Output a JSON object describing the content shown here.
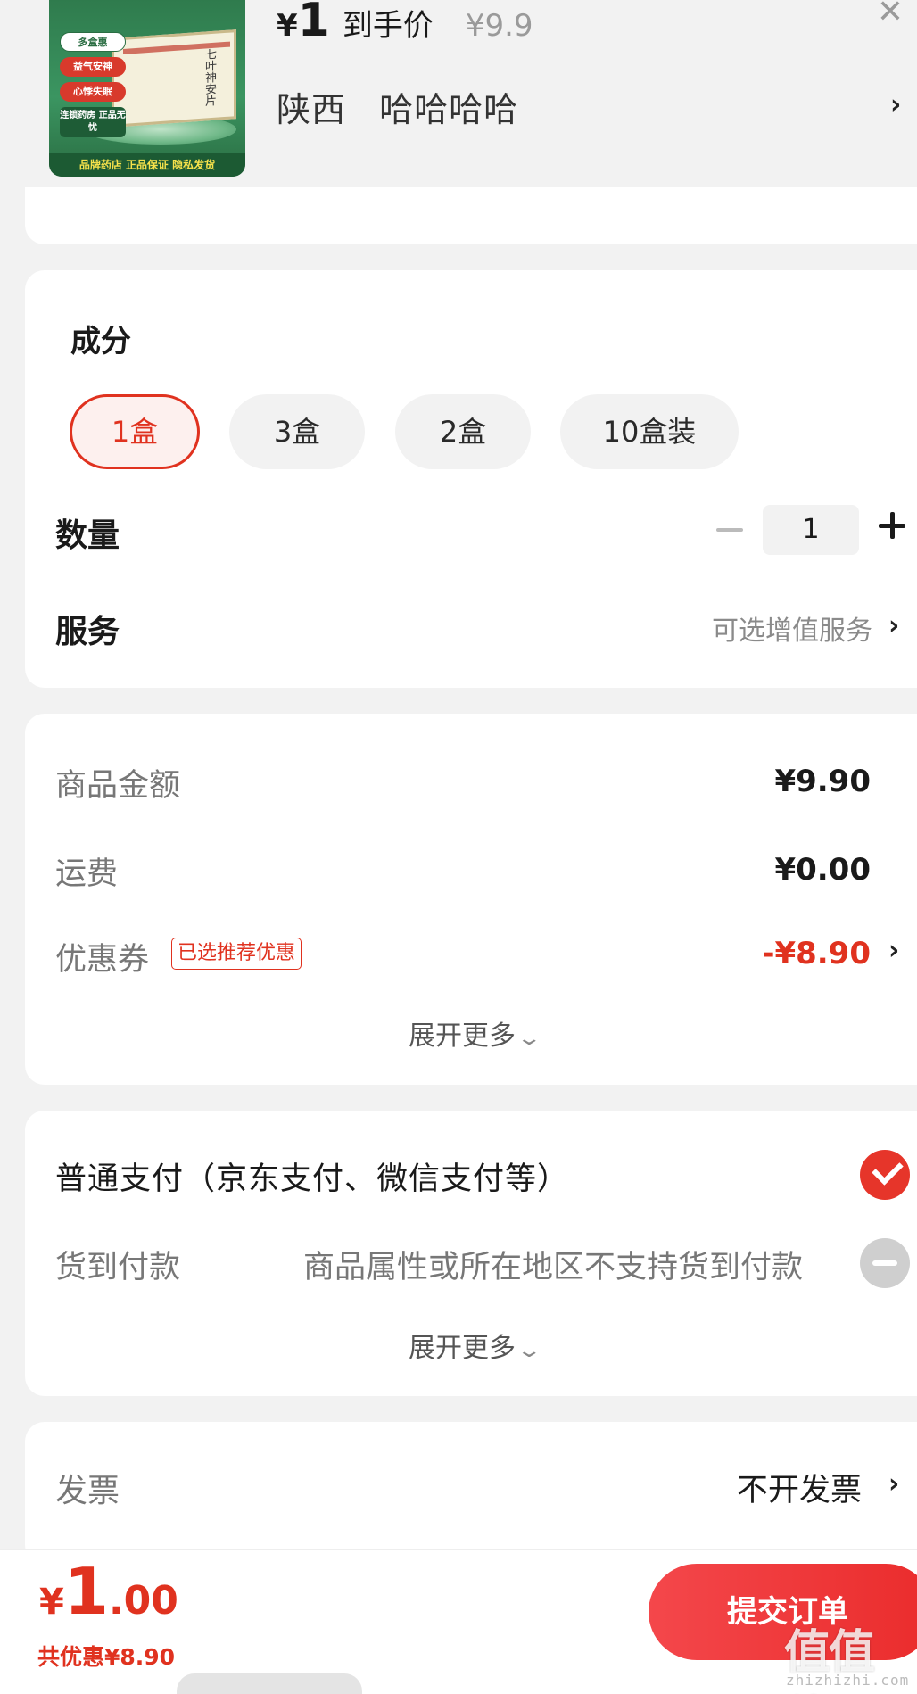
{
  "product": {
    "thumb": {
      "pill_1": "多盒惠",
      "pill_2": "益气安神",
      "pill_3": "心悸失眠",
      "pill_4": "连锁药房 正品无忧",
      "box_title": "七叶神安片",
      "footer": "品牌药店 正品保证 隐私发货"
    },
    "price_yen": "¥",
    "price_int": "1",
    "price_tag": "到手价",
    "price_original": "¥9.9",
    "address_region": "陕西",
    "address_detail": "哈哈哈哈"
  },
  "spec": {
    "title": "成分",
    "options": [
      "1盒",
      "3盒",
      "2盒",
      "10盒装"
    ],
    "selected": "1盒"
  },
  "quantity": {
    "label": "数量",
    "value": "1"
  },
  "service": {
    "label": "服务",
    "hint": "可选增值服务"
  },
  "summary": {
    "goods_label": "商品金额",
    "goods_value": "¥9.90",
    "shipping_label": "运费",
    "shipping_value": "¥0.00",
    "coupon_label": "优惠券",
    "coupon_badge": "已选推荐优惠",
    "coupon_value": "-¥8.90",
    "expand_label": "展开更多"
  },
  "payment": {
    "normal_label": "普通支付（京东支付、微信支付等）",
    "cod_label": "货到付款",
    "cod_note": "商品属性或所在地区不支持货到付款",
    "expand_label": "展开更多"
  },
  "invoice": {
    "label": "发票",
    "value": "不开发票"
  },
  "footer": {
    "total_yen": "¥",
    "total_int": "1",
    "total_dec": ".00",
    "saved": "共优惠¥8.90",
    "submit_label": "提交订单"
  },
  "watermark": {
    "text": "值值值",
    "url": "zhizhizhi.com"
  },
  "colors": {
    "accent": "#e0321f",
    "button": "#ea2c2c",
    "background": "#f2f2f2"
  }
}
